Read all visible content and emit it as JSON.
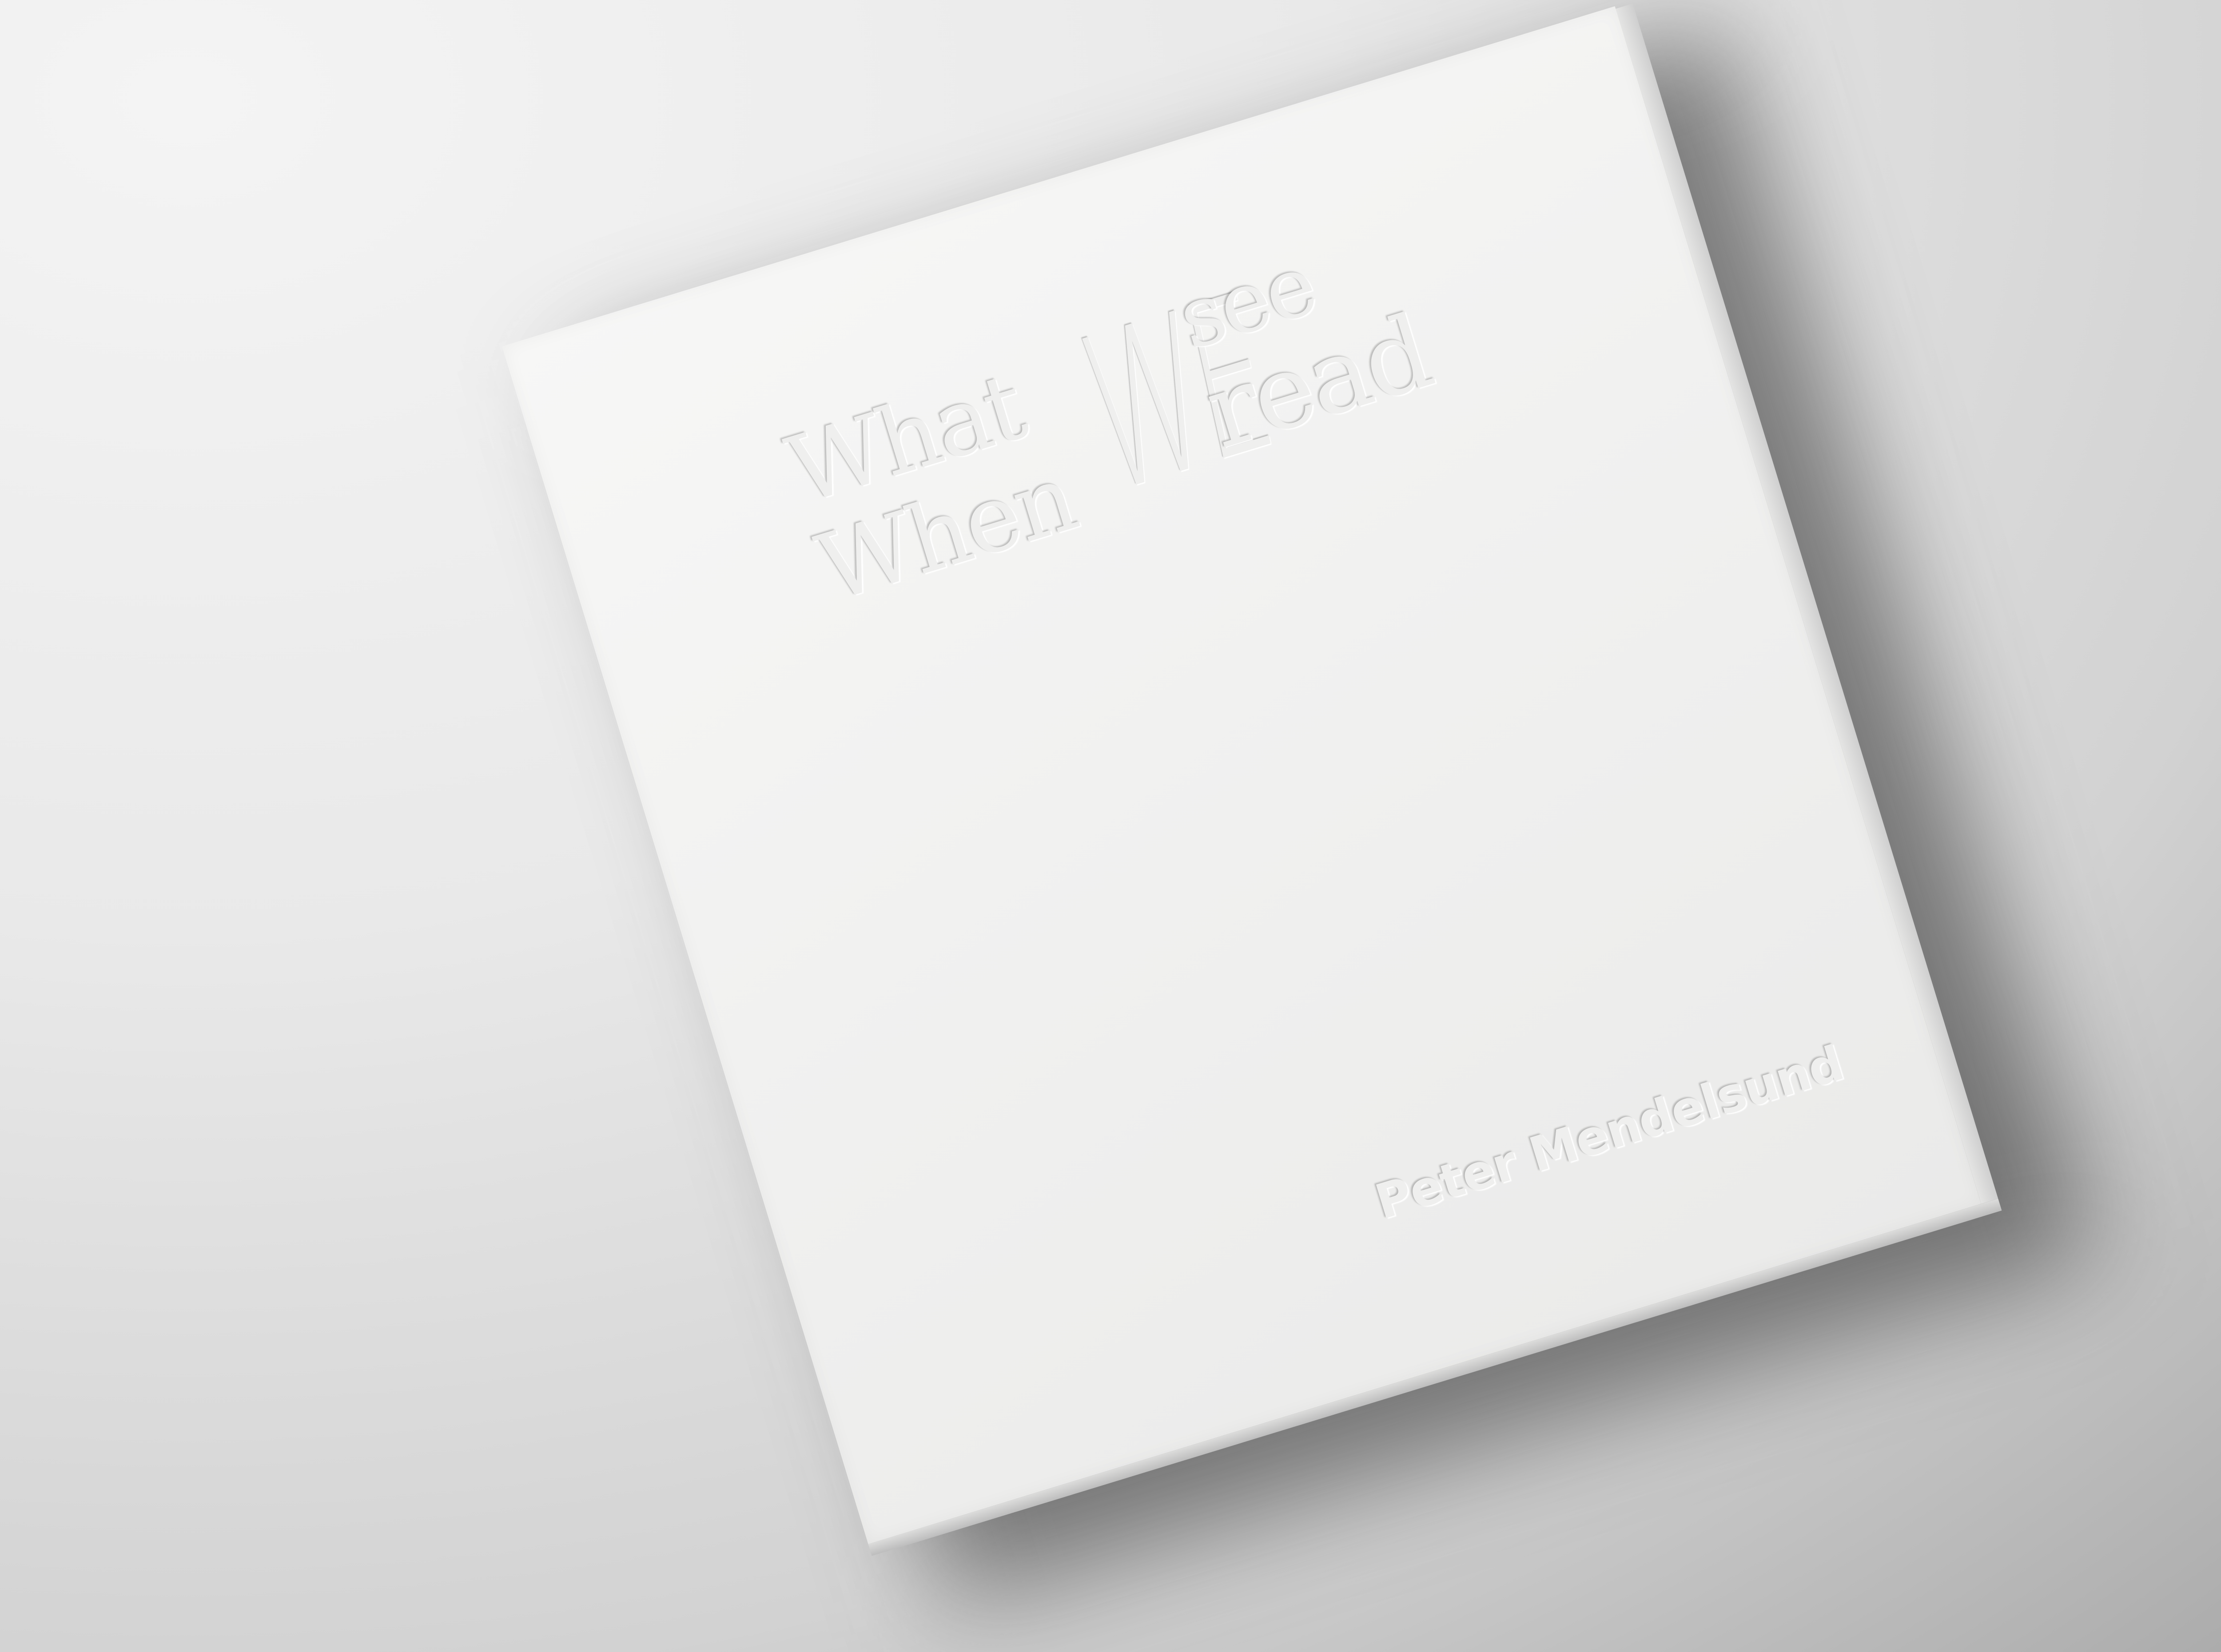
{
  "image": {
    "description_type": "photo",
    "background_color": "#e6e6e6",
    "cover_color": "#f3f3f2"
  },
  "book": {
    "title_words": {
      "what": "What",
      "when": "When",
      "we": "WE",
      "see": "see",
      "read": "read"
    },
    "author": "Peter Mendelsund"
  }
}
